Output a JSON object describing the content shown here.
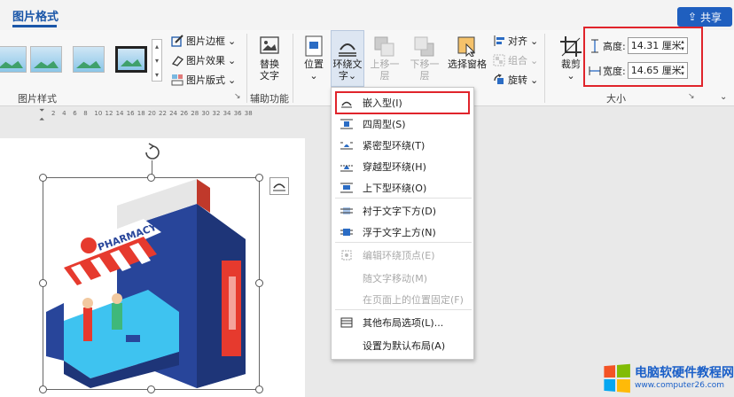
{
  "titlebar": {
    "active_tab": "图片格式",
    "share_label": "共享"
  },
  "picture_styles": {
    "group_label": "图片样式",
    "border_label": "图片边框",
    "effects_label": "图片效果",
    "layout_label": "图片版式"
  },
  "accessibility": {
    "group_label": "辅助功能",
    "replace_alt_text": "替换文字"
  },
  "arrange": {
    "position": "位置",
    "wrap_text_line1": "环绕文",
    "wrap_text_line2": "字",
    "bring_forward": "上移一层",
    "send_backward": "下移一层",
    "selection_pane": "选择窗格",
    "align": "对齐",
    "group": "组合",
    "rotate": "旋转"
  },
  "size": {
    "crop": "裁剪",
    "height_label": "高度:",
    "height_value": "14.31 厘米",
    "width_label": "宽度:",
    "width_value": "14.65 厘米",
    "group_label": "大小"
  },
  "ruler": {
    "ticks": [
      "2",
      "4",
      "6",
      "8",
      "10",
      "12",
      "14",
      "16",
      "18",
      "20",
      "22",
      "24",
      "26",
      "28",
      "30",
      "32",
      "34",
      "36",
      "38"
    ]
  },
  "wrap_menu": {
    "items": [
      {
        "label": "嵌入型(I)",
        "enabled": true
      },
      {
        "label": "四周型(S)",
        "enabled": true
      },
      {
        "label": "紧密型环绕(T)",
        "enabled": true
      },
      {
        "label": "穿越型环绕(H)",
        "enabled": true
      },
      {
        "label": "上下型环绕(O)",
        "enabled": true
      },
      {
        "label": "衬于文字下方(D)",
        "enabled": true
      },
      {
        "label": "浮于文字上方(N)",
        "enabled": true
      },
      {
        "label": "编辑环绕顶点(E)",
        "enabled": false
      },
      {
        "label": "随文字移动(M)",
        "enabled": false
      },
      {
        "label": "在页面上的位置固定(F)",
        "enabled": false
      },
      {
        "label": "其他布局选项(L)...",
        "enabled": true
      },
      {
        "label": "设置为默认布局(A)",
        "enabled": true
      }
    ]
  },
  "image": {
    "sign_text": "PHARMACY"
  },
  "watermark": {
    "title": "电脑软硬件教程网",
    "url": "www.computer26.com"
  },
  "colors": {
    "accent": "#1a56a8",
    "highlight": "#e0242b",
    "share_bg": "#1f5fbf"
  }
}
